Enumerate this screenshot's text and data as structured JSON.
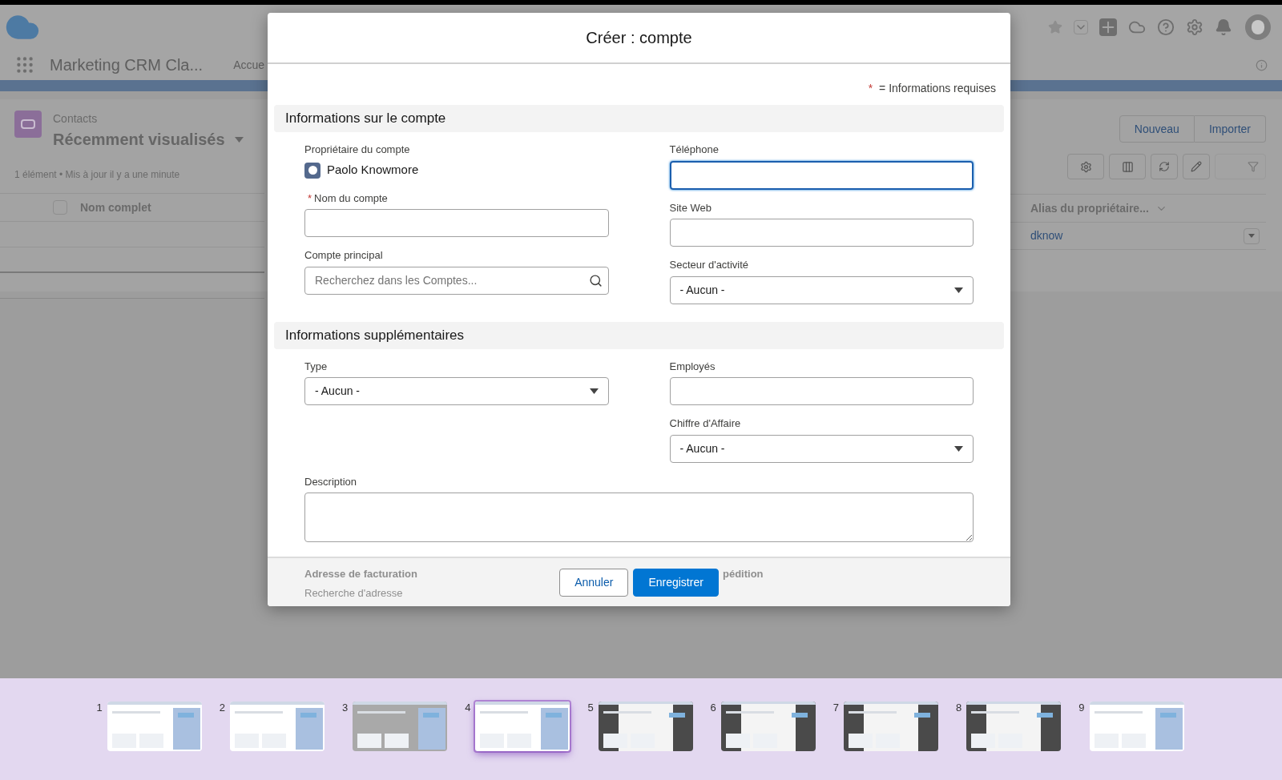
{
  "header": {
    "app_name": "Marketing CRM Cla...",
    "tab": "Accue"
  },
  "list_view": {
    "object": "Contacts",
    "view_name": "Récemment visualisés",
    "status": "1 élément • Mis à jour il y a une minute",
    "actions": [
      "Nouveau",
      "Importer"
    ],
    "select_all": {
      "checked": false
    },
    "columns": [
      "Nom complet",
      "Alias du propriétaire..."
    ],
    "rows": [
      {
        "owner_alias": "dknow"
      }
    ]
  },
  "modal": {
    "title": "Créer : compte",
    "required_mark": "*",
    "required_note": "= Informations requises",
    "sections": [
      {
        "title": "Informations sur le compte",
        "left": [
          {
            "kind": "owner",
            "label": "Propriétaire du compte",
            "value": "Paolo Knowmore",
            "required": false
          },
          {
            "kind": "text",
            "label": "Nom du compte",
            "required": true,
            "focused": false
          },
          {
            "kind": "lookup",
            "label": "Compte principal",
            "placeholder": "Recherchez dans les Comptes...",
            "required": false
          }
        ],
        "right": [
          {
            "kind": "text",
            "label": "Téléphone",
            "required": false,
            "focused": true
          },
          {
            "kind": "text",
            "label": "Site Web",
            "required": false,
            "focused": false
          },
          {
            "kind": "select",
            "label": "Secteur d'activité",
            "value": "- Aucun -",
            "required": false
          }
        ]
      },
      {
        "title": "Informations supplémentaires",
        "left": [
          {
            "kind": "select",
            "label": "Type",
            "value": "- Aucun -",
            "required": false
          }
        ],
        "right": [
          {
            "kind": "text",
            "label": "Employés",
            "required": false,
            "focused": false
          },
          {
            "kind": "select",
            "label": "Chiffre d'Affaire",
            "value": "- Aucun -",
            "required": false
          }
        ],
        "full": [
          {
            "kind": "textarea",
            "label": "Description",
            "required": false
          }
        ]
      }
    ],
    "behind_footer": [
      "Adresse de facturation",
      "Recherche d'adresse",
      "pédition"
    ],
    "buttons": [
      {
        "label": "Annuler",
        "kind": "neutral"
      },
      {
        "label": "Enregistrer",
        "kind": "brand"
      }
    ]
  },
  "slides": [
    {
      "number": "1",
      "selected": false,
      "kind": "light"
    },
    {
      "number": "2",
      "selected": false,
      "kind": "light"
    },
    {
      "number": "3",
      "selected": false,
      "kind": "gray"
    },
    {
      "number": "4",
      "selected": true,
      "kind": "light"
    },
    {
      "number": "5",
      "selected": false,
      "kind": "dark"
    },
    {
      "number": "6",
      "selected": false,
      "kind": "dark"
    },
    {
      "number": "7",
      "selected": false,
      "kind": "dark"
    },
    {
      "number": "8",
      "selected": false,
      "kind": "dark"
    },
    {
      "number": "9",
      "selected": false,
      "kind": "light"
    }
  ]
}
